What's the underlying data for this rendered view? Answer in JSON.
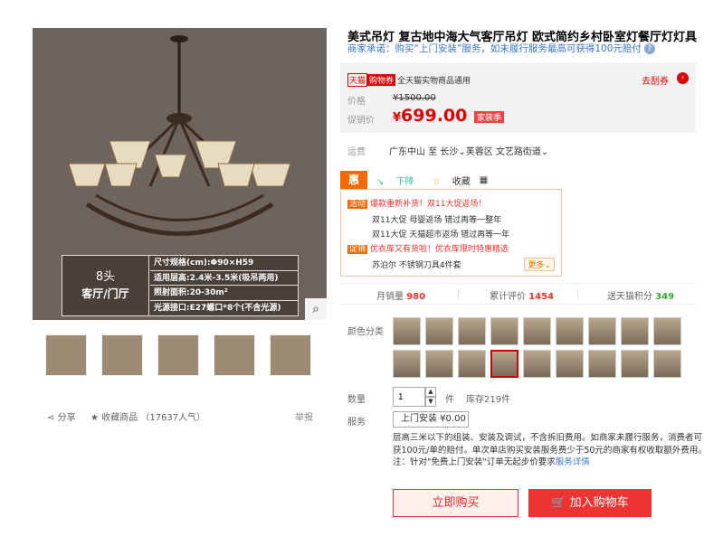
{
  "gallery": {
    "zoom_icon": "search-icon",
    "spec": {
      "heads": "8头",
      "room": "客厅/门厅",
      "rows": [
        "尺寸规格(cm):Φ90×H59",
        "适用层高:2.4米-3.5米(吸吊两用)",
        "照射面积:20-30m²",
        "光源接口:E27螺口*8个(不含光源)"
      ]
    },
    "share_label": "分享",
    "fav_label": "收藏商品",
    "fav_count": "（17637人气）",
    "report_label": "举报"
  },
  "product": {
    "title": "美式吊灯 复古地中海大气客厅吊灯 欧式简约乡村卧室灯餐厅灯灯具",
    "promise": "商家承诺：购买“上门安装”服务，如未履行服务最高可获得100元赔付"
  },
  "pricing": {
    "tag1": "天猫",
    "tag2": "购物券",
    "tag_text": "全天猫实物商品通用",
    "coupon_link": "去刮券",
    "price_label": "价格",
    "old_price": "¥1500.00",
    "promo_label": "促销价",
    "currency": "¥",
    "price": "699.00",
    "price_tag": "家装季"
  },
  "shipping": {
    "label": "运费",
    "value": "广东中山 至 长沙⌄芙蓉区 文艺路街道⌄"
  },
  "tools": {
    "hui": "惠",
    "down": "下降",
    "fav": "收藏",
    "qr": "▦"
  },
  "promo": {
    "r1_tag": "活动",
    "r1": "爆款重新补货！双11大促返场！",
    "r2": "双11大促 母婴返场 错过再等一整年",
    "r3": "双11大促 天猫超市返场 错过再等一年",
    "r4_tag": "促销",
    "r4": "优衣库又有货啦！优衣库限时特惠精选",
    "r5": "苏泊尔 不锈钢刀具4件套",
    "more": "更多⌄"
  },
  "stats": {
    "monthly_label": "月销量",
    "monthly": "980",
    "reviews_label": "累计评价",
    "reviews": "1454",
    "points_label": "送天猫积分",
    "points": "349"
  },
  "sku": {
    "color_label": "颜色分类",
    "selected_index": 12
  },
  "quantity": {
    "label": "数量",
    "value": "1",
    "unit": "件",
    "stock": "库存219件"
  },
  "service": {
    "label": "服务",
    "button": "上门安装 ¥0.00",
    "desc": "层高三米以下的组装、安装及调试，不含拆旧费用。如商家未履行服务，消费者可获100元/单的赔付。单次单店购买安装服务费少于50元的商家有权收取额外费用。注：针对\"免费上门安装\"订单无起步价要求",
    "link": "服务详情"
  },
  "actions": {
    "buy": "立即购买",
    "cart": "加入购物车"
  }
}
